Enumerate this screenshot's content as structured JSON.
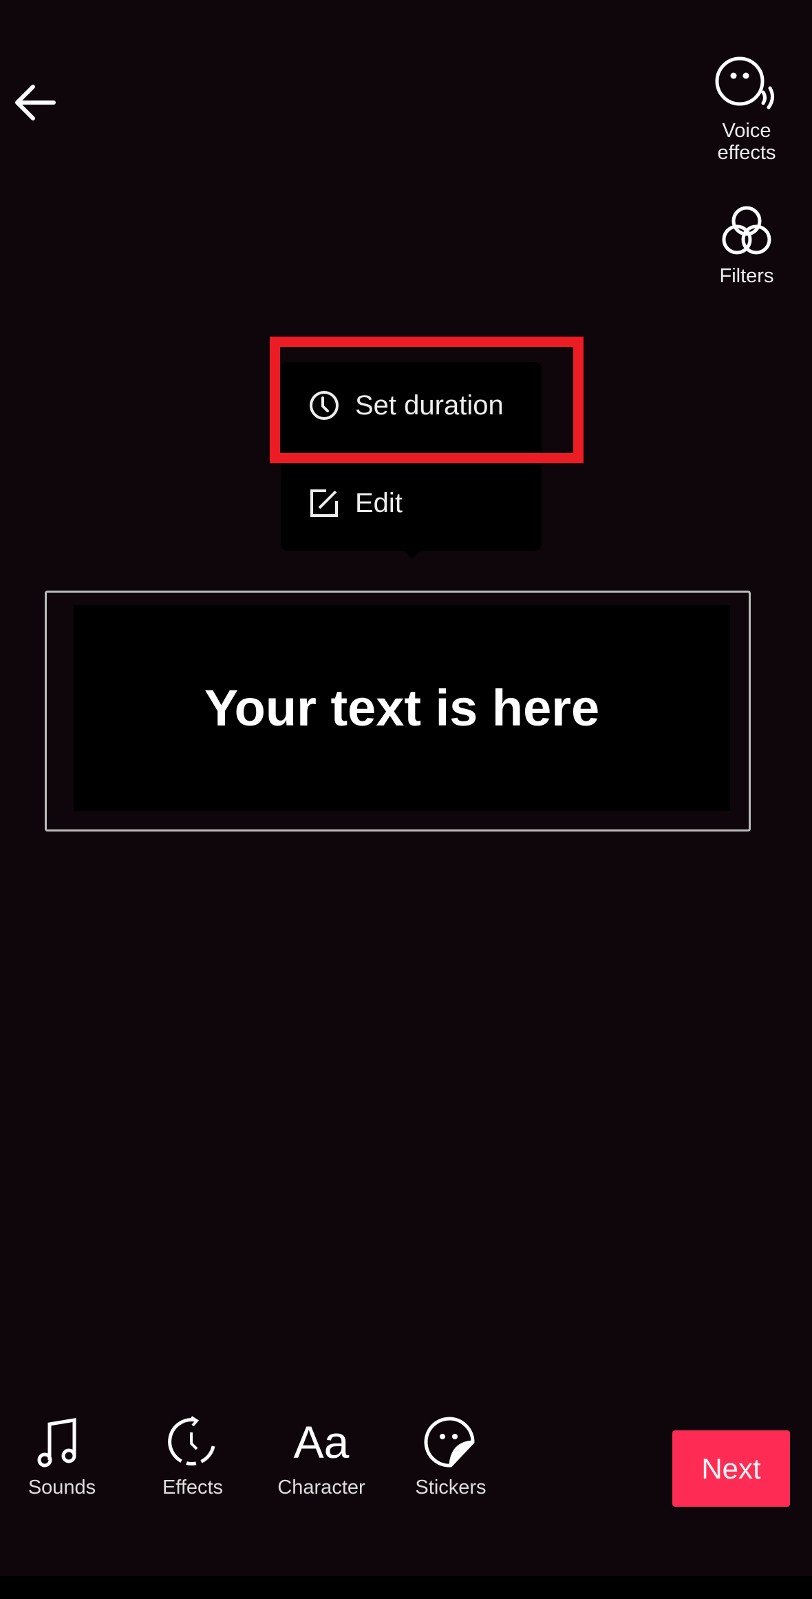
{
  "top_bar": {
    "back_icon": "arrow-left-icon"
  },
  "right_rail": [
    {
      "label": "Voice\neffects",
      "line1": "Voice",
      "line2": "effects",
      "icon": "voice-effects-icon"
    },
    {
      "label": "Filters",
      "icon": "filters-icon"
    }
  ],
  "context_menu": {
    "items": [
      {
        "label": "Set duration",
        "icon": "clock-icon",
        "highlighted": true
      },
      {
        "label": "Edit",
        "icon": "edit-icon"
      }
    ]
  },
  "text_overlay": {
    "text": "Your text is here"
  },
  "toolbar": {
    "items": [
      {
        "label": "Sounds",
        "icon": "music-note-icon"
      },
      {
        "label": "Effects",
        "icon": "effects-timer-icon"
      },
      {
        "label": "Character",
        "icon": "text-aa-icon"
      },
      {
        "label": "Stickers",
        "icon": "sticker-icon"
      }
    ],
    "next_label": "Next"
  },
  "colors": {
    "accent": "#fe2c55",
    "highlight": "#ec1c24",
    "background": "#0e060b"
  }
}
